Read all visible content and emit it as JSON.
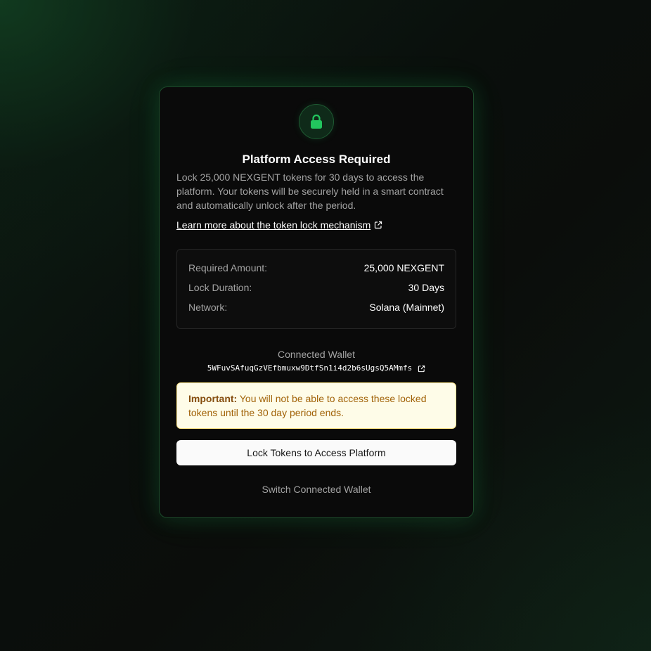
{
  "card": {
    "icon": "lock-icon",
    "title": "Platform Access Required",
    "description": "Lock 25,000 NEXGENT tokens for 30 days to access the platform. Your tokens will be securely held in a smart contract and automatically unlock after the period.",
    "learn_more": "Learn more about the token lock mechanism",
    "details": [
      {
        "label": "Required Amount:",
        "value": "25,000 NEXGENT"
      },
      {
        "label": "Lock Duration:",
        "value": "30 Days"
      },
      {
        "label": "Network:",
        "value": "Solana (Mainnet)"
      }
    ],
    "wallet_label": "Connected Wallet",
    "wallet_address": "5WFuvSAfuqGzVEfbmuxw9DtfSn1i4d2b6sUgsQ5AMmfs",
    "warning_prefix": "Important:",
    "warning_text": " You will not be able to access these locked tokens until the 30 day period ends.",
    "lock_button": "Lock Tokens to Access Platform",
    "switch_button": "Switch Connected Wallet"
  },
  "colors": {
    "accent": "#22c55e",
    "card_border": "#1c4a2a",
    "warning_bg": "#fefce8",
    "warning_text": "#a16207"
  }
}
